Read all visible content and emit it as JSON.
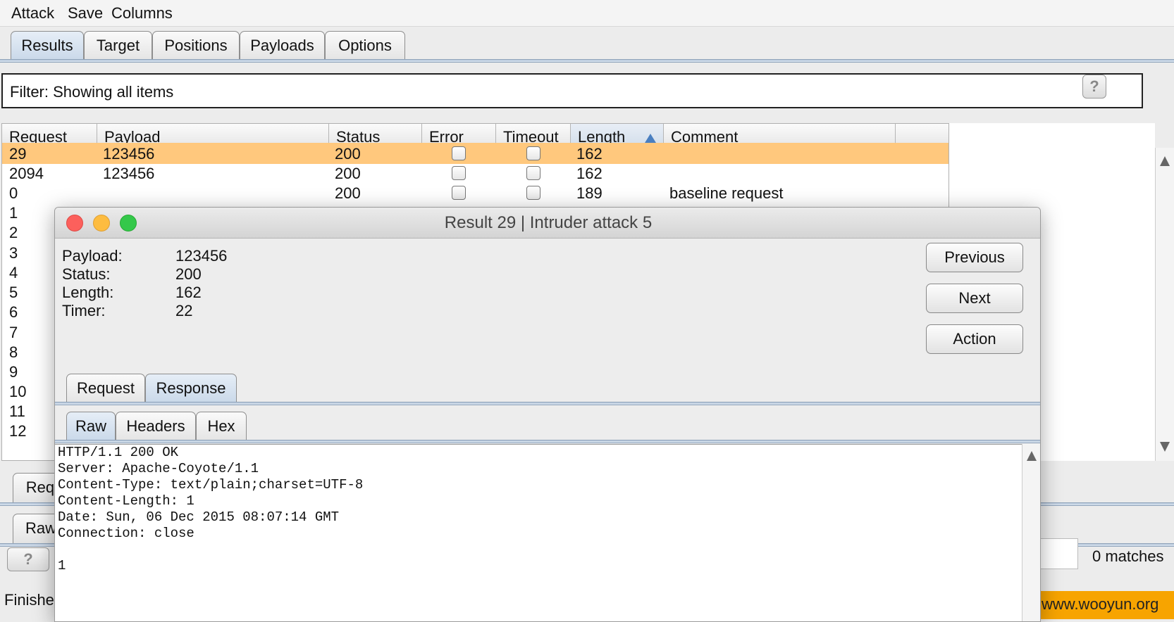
{
  "menu": [
    "Attack",
    "Save",
    "Columns"
  ],
  "main_tabs": [
    "Results",
    "Target",
    "Positions",
    "Payloads",
    "Options"
  ],
  "filter": {
    "text": "Filter: Showing all items",
    "help": "?"
  },
  "table": {
    "columns": [
      "Request",
      "Payload",
      "Status",
      "Error",
      "Timeout",
      "Length",
      "Comment"
    ],
    "sorted_column": "Length",
    "rows": [
      {
        "request": "29",
        "payload": "123456",
        "status": "200",
        "length": "162",
        "comment": ""
      },
      {
        "request": "2094",
        "payload": "123456",
        "status": "200",
        "length": "162",
        "comment": ""
      },
      {
        "request": "0",
        "payload": "",
        "status": "200",
        "length": "189",
        "comment": "baseline request"
      },
      {
        "request": "1"
      },
      {
        "request": "2"
      },
      {
        "request": "3"
      },
      {
        "request": "4"
      },
      {
        "request": "5"
      },
      {
        "request": "6"
      },
      {
        "request": "7"
      },
      {
        "request": "8"
      },
      {
        "request": "9"
      },
      {
        "request": "10"
      },
      {
        "request": "11"
      },
      {
        "request": "12"
      }
    ]
  },
  "lower_pane": {
    "tab_partial_1": "Requ",
    "tab_partial_2": "Raw",
    "help": "?",
    "status_partial": "Finishe",
    "matches": "0 matches",
    "watermark": "www.wooyun.org"
  },
  "dialog": {
    "title": "Result 29 | Intruder attack 5",
    "info": {
      "payload_label": "Payload:",
      "payload": "123456",
      "status_label": "Status:",
      "status": "200",
      "length_label": "Length:",
      "length": "162",
      "timer_label": "Timer:",
      "timer": "22"
    },
    "buttons": {
      "previous": "Previous",
      "next": "Next",
      "action": "Action"
    },
    "tabs": [
      "Request",
      "Response"
    ],
    "subtabs": [
      "Raw",
      "Headers",
      "Hex"
    ],
    "raw_lines": [
      "HTTP/1.1 200 OK",
      "Server: Apache-Coyote/1.1",
      "Content-Type: text/plain;charset=UTF-8",
      "Content-Length: 1",
      "Date: Sun, 06 Dec 2015 08:07:14 GMT",
      "Connection: close",
      "",
      "1"
    ]
  },
  "colors": {
    "selected_row": "#ffc87d",
    "tab_active": "#c9d8e9",
    "close": "#fc605c",
    "minimize": "#fdbc40",
    "zoom": "#34c84a"
  }
}
